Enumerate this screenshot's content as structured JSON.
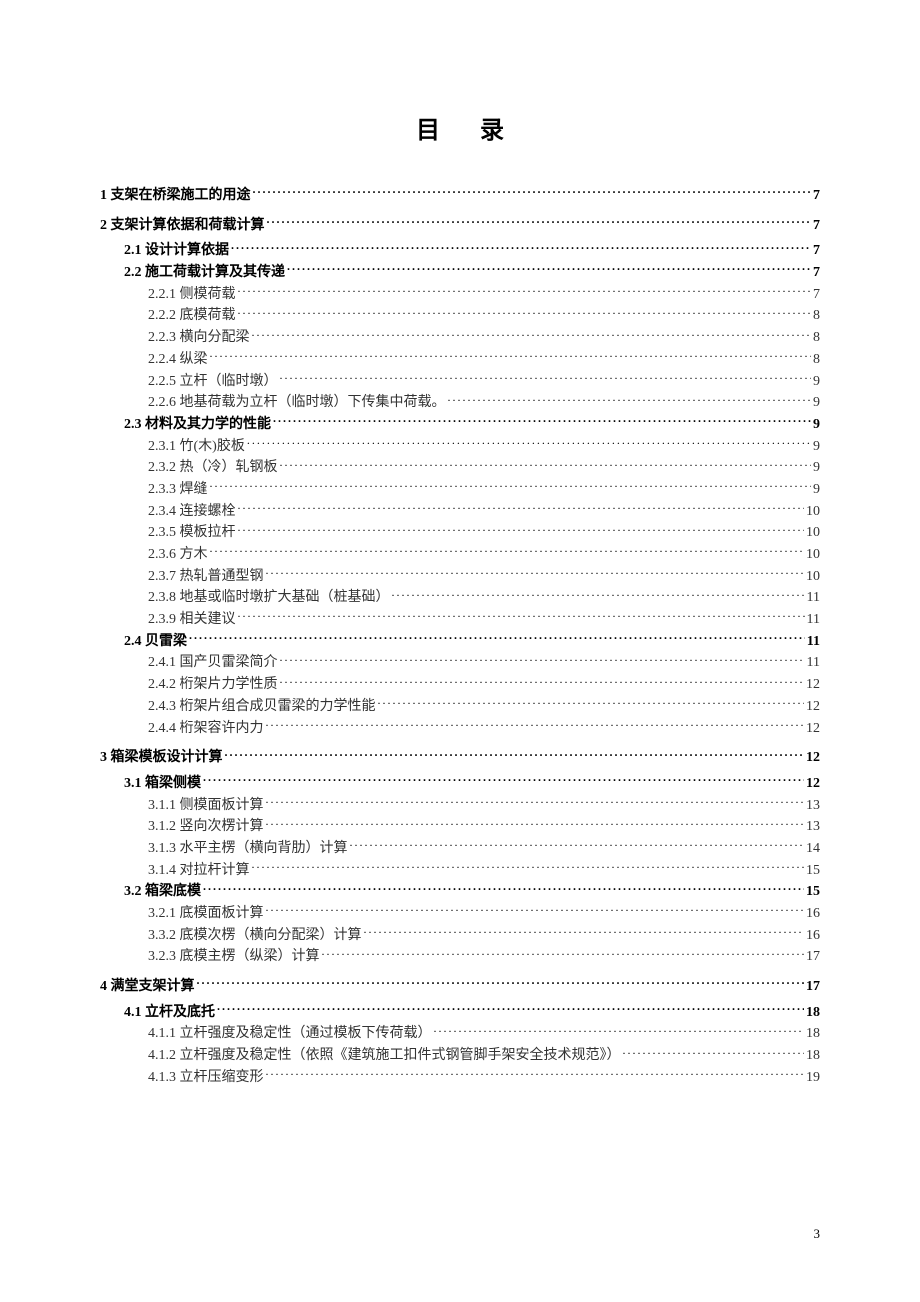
{
  "title": "目录",
  "footer_page": "3",
  "toc": [
    {
      "level": 1,
      "label": "1 支架在桥梁施工的用途",
      "page": "7"
    },
    {
      "level": 1,
      "label": "2 支架计算依据和荷载计算",
      "page": "7"
    },
    {
      "level": 2,
      "label": "2.1 设计计算依据",
      "page": "7"
    },
    {
      "level": 2,
      "label": "2.2 施工荷载计算及其传递",
      "page": "7"
    },
    {
      "level": 3,
      "label": "2.2.1 侧模荷载",
      "page": "7"
    },
    {
      "level": 3,
      "label": "2.2.2 底模荷载",
      "page": "8"
    },
    {
      "level": 3,
      "label": "2.2.3 横向分配梁",
      "page": "8"
    },
    {
      "level": 3,
      "label": "2.2.4 纵梁",
      "page": "8"
    },
    {
      "level": 3,
      "label": "2.2.5 立杆（临时墩）",
      "page": "9"
    },
    {
      "level": 3,
      "label": "2.2.6 地基荷载为立杆（临时墩）下传集中荷载。",
      "page": "9"
    },
    {
      "level": 2,
      "label": "2.3 材料及其力学的性能",
      "page": "9"
    },
    {
      "level": 3,
      "label": "2.3.1 竹(木)胶板",
      "page": "9"
    },
    {
      "level": 3,
      "label": "2.3.2 热（冷）轧钢板",
      "page": "9"
    },
    {
      "level": 3,
      "label": "2.3.3 焊缝",
      "page": "9"
    },
    {
      "level": 3,
      "label": "2.3.4 连接螺栓",
      "page": "10"
    },
    {
      "level": 3,
      "label": "2.3.5 模板拉杆",
      "page": "10"
    },
    {
      "level": 3,
      "label": "2.3.6 方木",
      "page": "10"
    },
    {
      "level": 3,
      "label": "2.3.7 热轧普通型钢",
      "page": "10"
    },
    {
      "level": 3,
      "label": "2.3.8 地基或临时墩扩大基础（桩基础）",
      "page": "11"
    },
    {
      "level": 3,
      "label": "2.3.9 相关建议",
      "page": "11"
    },
    {
      "level": 2,
      "label": "2.4 贝雷梁",
      "page": "11"
    },
    {
      "level": 3,
      "label": "2.4.1 国产贝雷梁简介",
      "page": "11"
    },
    {
      "level": 3,
      "label": "2.4.2 桁架片力学性质",
      "page": "12"
    },
    {
      "level": 3,
      "label": "2.4.3 桁架片组合成贝雷梁的力学性能",
      "page": "12"
    },
    {
      "level": 3,
      "label": "2.4.4 桁架容许内力",
      "page": "12"
    },
    {
      "level": 1,
      "label": "3 箱梁模板设计计算",
      "page": "12"
    },
    {
      "level": 2,
      "label": "3.1 箱梁侧模",
      "page": "12"
    },
    {
      "level": 3,
      "label": "3.1.1 侧模面板计算",
      "page": "13"
    },
    {
      "level": 3,
      "label": "3.1.2 竖向次楞计算",
      "page": "13"
    },
    {
      "level": 3,
      "label": "3.1.3 水平主楞（横向背肋）计算",
      "page": "14"
    },
    {
      "level": 3,
      "label": "3.1.4 对拉杆计算",
      "page": "15"
    },
    {
      "level": 2,
      "label": "3.2 箱梁底模",
      "page": "15"
    },
    {
      "level": 3,
      "label": "3.2.1 底模面板计算",
      "page": "16"
    },
    {
      "level": 3,
      "label": "3.3.2 底模次楞（横向分配梁）计算",
      "page": "16"
    },
    {
      "level": 3,
      "label": "3.2.3 底模主楞（纵梁）计算",
      "page": "17"
    },
    {
      "level": 1,
      "label": "4 满堂支架计算",
      "page": "17"
    },
    {
      "level": 2,
      "label": "4.1 立杆及底托",
      "page": "18"
    },
    {
      "level": 3,
      "label": "4.1.1 立杆强度及稳定性（通过模板下传荷载）",
      "page": "18"
    },
    {
      "level": 3,
      "label": "4.1.2 立杆强度及稳定性（依照《建筑施工扣件式钢管脚手架安全技术规范》）",
      "page": "18"
    },
    {
      "level": 3,
      "label": "4.1.3 立杆压缩变形",
      "page": "19"
    }
  ]
}
